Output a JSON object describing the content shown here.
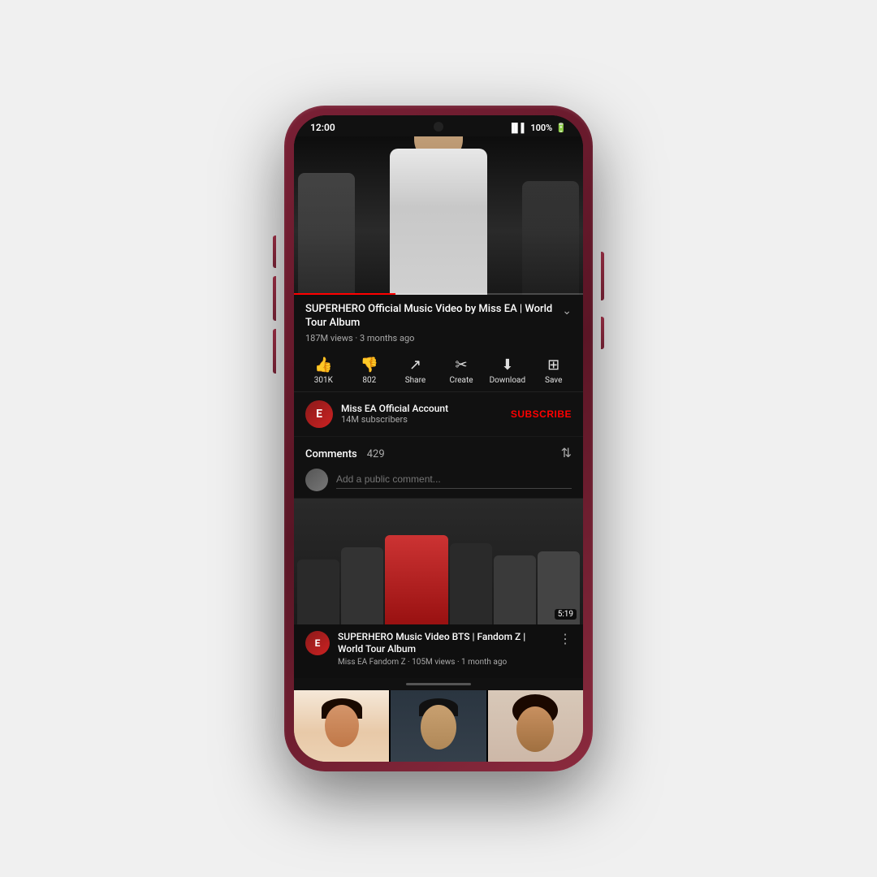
{
  "phone": {
    "status_bar": {
      "time": "12:00",
      "signal": "signal-icon",
      "battery": "100%"
    },
    "video": {
      "title": "SUPERHERO Official Music Video by Miss EA | World Tour Album",
      "views": "187M views",
      "time_ago": "3 months ago",
      "meta": "187M views · 3 months ago",
      "progress_percent": 35
    },
    "actions": [
      {
        "icon": "👍",
        "label": "301K",
        "id": "like"
      },
      {
        "icon": "👎",
        "label": "802",
        "id": "dislike"
      },
      {
        "icon": "↗",
        "label": "Share",
        "id": "share"
      },
      {
        "icon": "✂",
        "label": "Create",
        "id": "create"
      },
      {
        "icon": "⬇",
        "label": "Download",
        "id": "download"
      },
      {
        "icon": "⊞",
        "label": "Save",
        "id": "save"
      }
    ],
    "channel": {
      "name": "Miss EA Official Account",
      "subscribers": "14M subscribers",
      "subscribe_label": "SUBSCRIBE"
    },
    "comments": {
      "label": "Comments",
      "count": "429",
      "placeholder": "Add a public comment..."
    },
    "next_video": {
      "title": "SUPERHERO Music Video BTS | Fandom Z | World Tour Album",
      "channel": "Miss EA Fandom Z",
      "views": "105M views",
      "time_ago": "1 month ago",
      "meta": "Miss EA Fandom Z · 105M views · 1 month ago",
      "duration": "5:19"
    }
  }
}
